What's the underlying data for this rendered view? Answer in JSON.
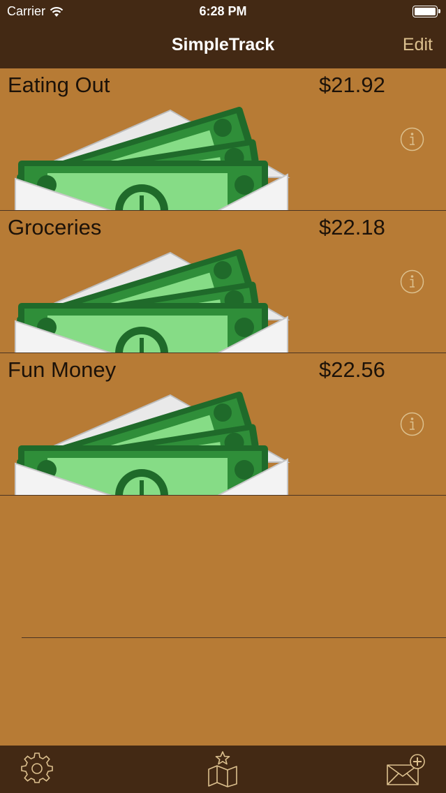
{
  "status_bar": {
    "carrier": "Carrier",
    "time": "6:28 PM",
    "icons": [
      "wifi-icon",
      "battery-icon"
    ]
  },
  "nav": {
    "title": "SimpleTrack",
    "edit_label": "Edit"
  },
  "envelopes": [
    {
      "name": "Eating Out",
      "amount": "$21.92",
      "icon": "envelope-cash-icon"
    },
    {
      "name": "Groceries",
      "amount": "$22.18",
      "icon": "envelope-cash-icon"
    },
    {
      "name": "Fun Money",
      "amount": "$22.56",
      "icon": "envelope-cash-icon"
    }
  ],
  "tabbar": {
    "icons": [
      "gear-icon",
      "map-icon",
      "mail-add-icon"
    ]
  },
  "colors": {
    "bar_background": "#432914",
    "content_background": "#b77b35",
    "accent": "#dcc08e",
    "text": "#1c1209"
  }
}
